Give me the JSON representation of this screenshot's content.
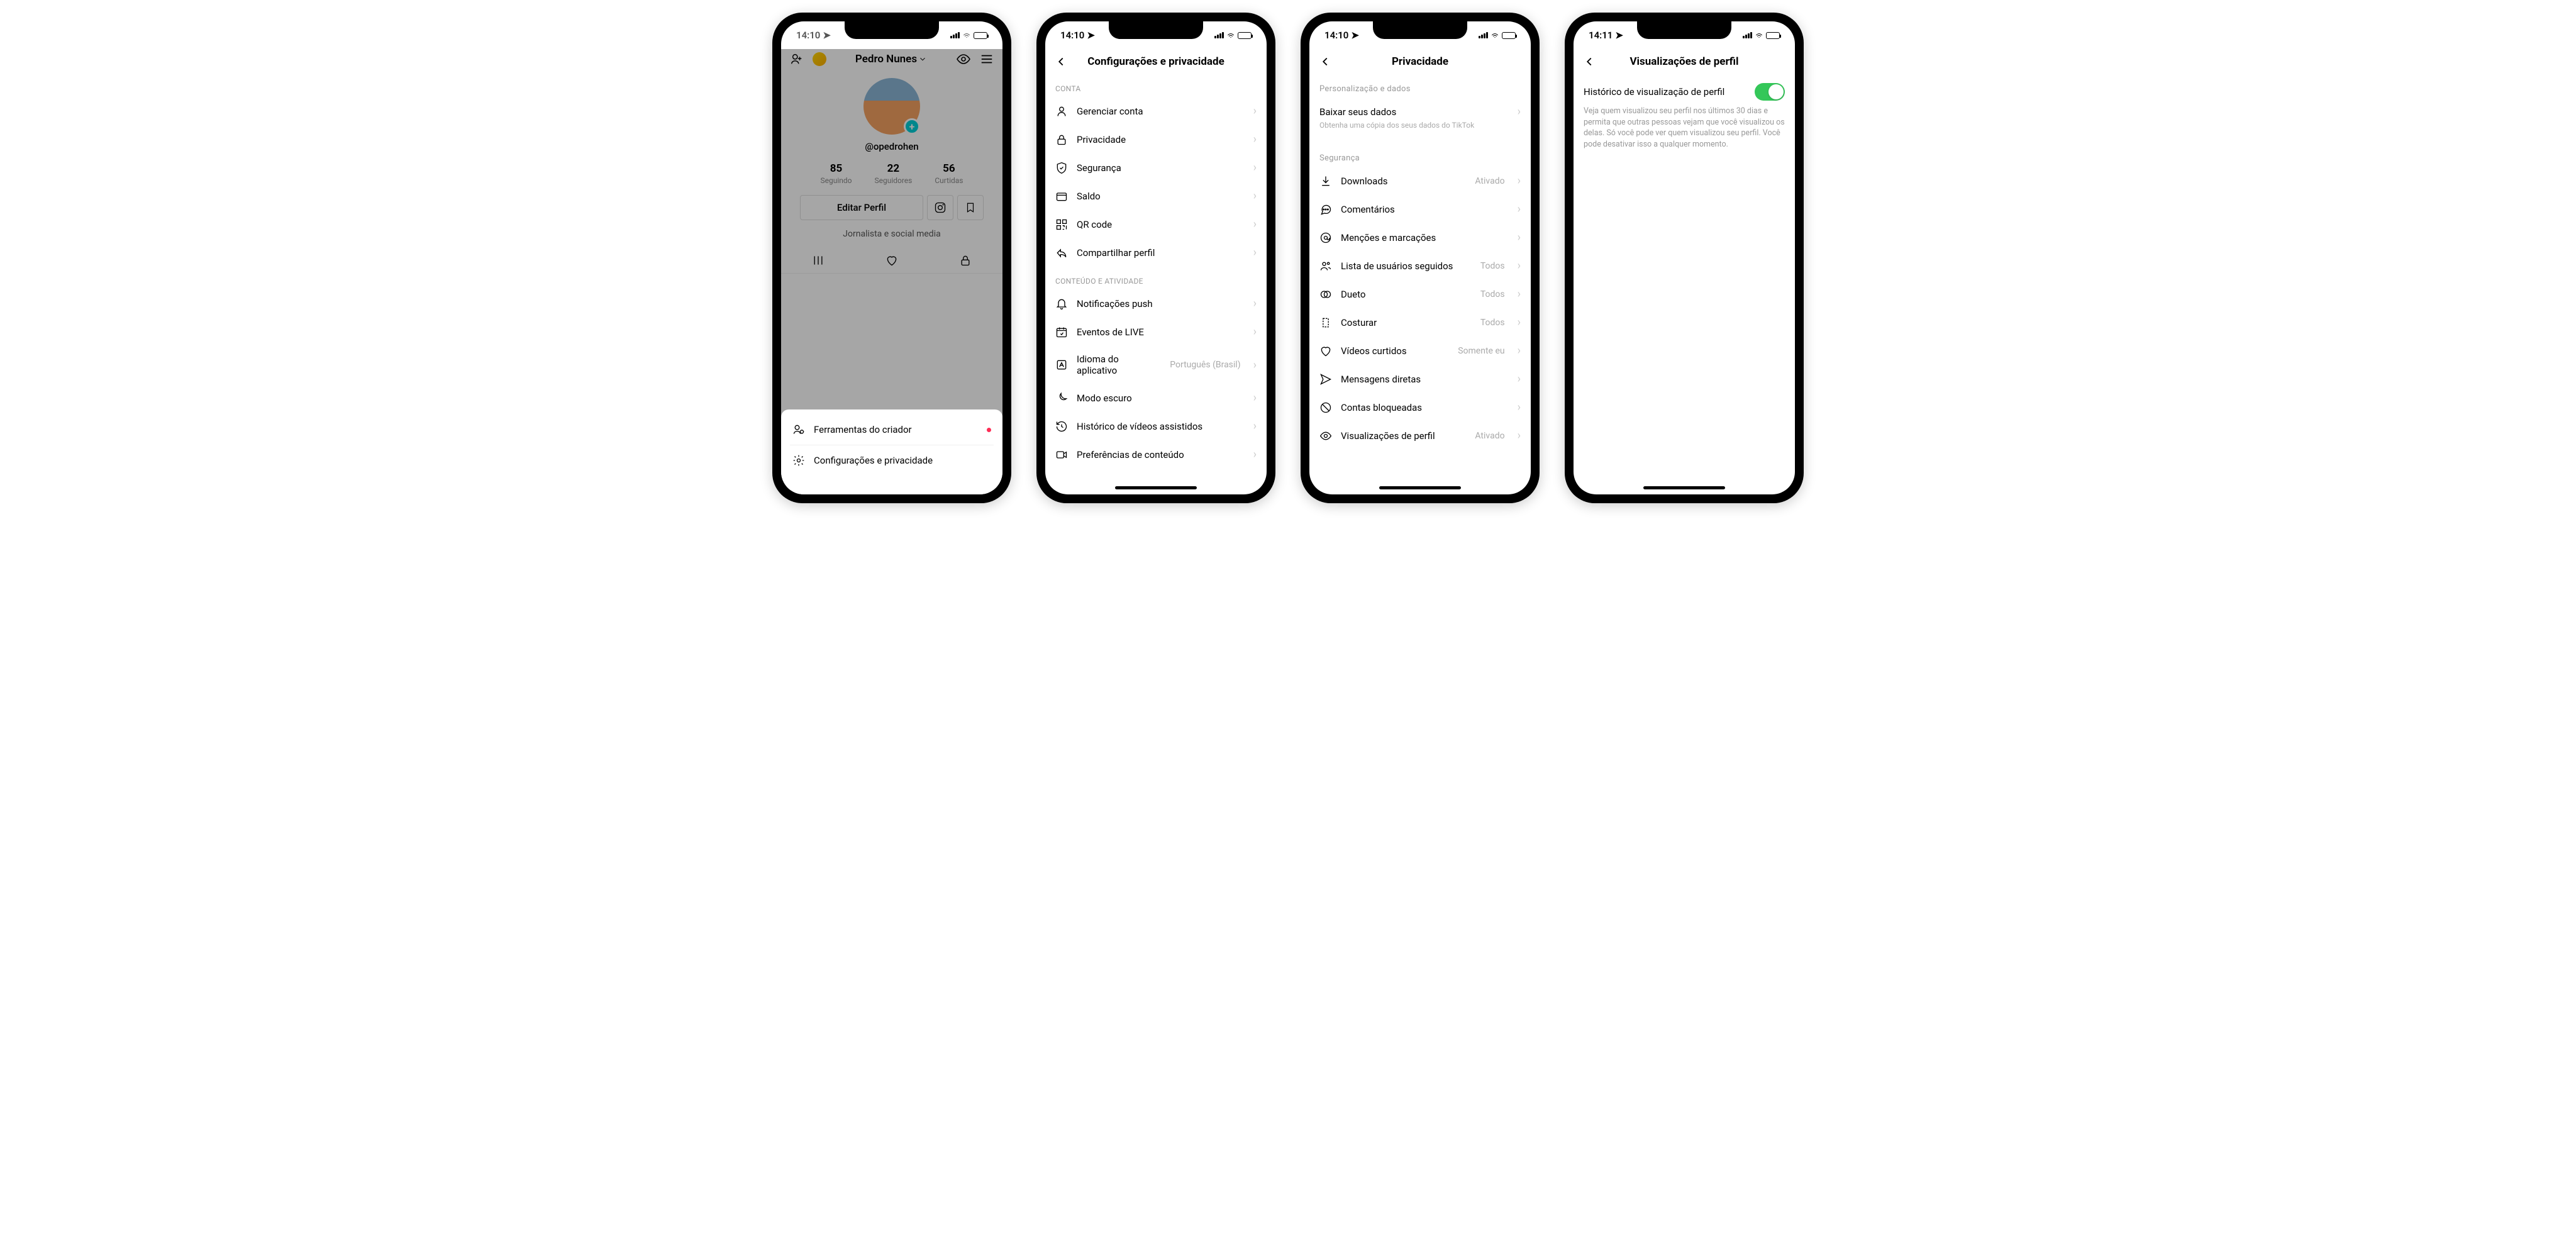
{
  "phone1": {
    "time": "14:10",
    "header_name": "Pedro Nunes",
    "handle": "@opedrohen",
    "stats": {
      "following_num": "85",
      "following_lbl": "Seguindo",
      "followers_num": "22",
      "followers_lbl": "Seguidores",
      "likes_num": "56",
      "likes_lbl": "Curtidas"
    },
    "edit_profile": "Editar Perfil",
    "bio": "Jornalista e social media",
    "sheet": {
      "creator_tools": "Ferramentas do criador",
      "settings": "Configurações e privacidade"
    }
  },
  "phone2": {
    "time": "14:10",
    "title": "Configurações e privacidade",
    "section_account": "CONTA",
    "section_content": "CONTEÚDO E ATIVIDADE",
    "items": {
      "manage": "Gerenciar conta",
      "privacy": "Privacidade",
      "security": "Segurança",
      "balance": "Saldo",
      "qr": "QR code",
      "share": "Compartilhar perfil",
      "push": "Notificações push",
      "live": "Eventos de LIVE",
      "language": "Idioma do aplicativo",
      "language_val": "Português (Brasil)",
      "dark": "Modo escuro",
      "history": "Histórico de vídeos assistidos",
      "content_pref": "Preferências de conteúdo"
    }
  },
  "phone3": {
    "time": "14:10",
    "title": "Privacidade",
    "section_personalization": "Personalização e dados",
    "section_security": "Segurança",
    "download_data": "Baixar seus dados",
    "download_data_sub": "Obtenha uma cópia dos seus dados do TikTok",
    "items": {
      "downloads": "Downloads",
      "downloads_val": "Ativado",
      "comments": "Comentários",
      "mentions": "Menções e marcações",
      "following_list": "Lista de usuários seguidos",
      "following_list_val": "Todos",
      "duet": "Dueto",
      "duet_val": "Todos",
      "stitch": "Costurar",
      "stitch_val": "Todos",
      "liked": "Vídeos curtidos",
      "liked_val": "Somente eu",
      "dm": "Mensagens diretas",
      "blocked": "Contas bloqueadas",
      "profile_views": "Visualizações de perfil",
      "profile_views_val": "Ativado"
    }
  },
  "phone4": {
    "time": "14:11",
    "title": "Visualizações de perfil",
    "toggle_label": "Histórico de visualização de perfil",
    "description": "Veja quem visualizou seu perfil nos últimos 30 dias e permita que outras pessoas vejam que você visualizou os delas. Só você pode ver quem visualizou seu perfil. Você pode desativar isso a qualquer momento."
  }
}
